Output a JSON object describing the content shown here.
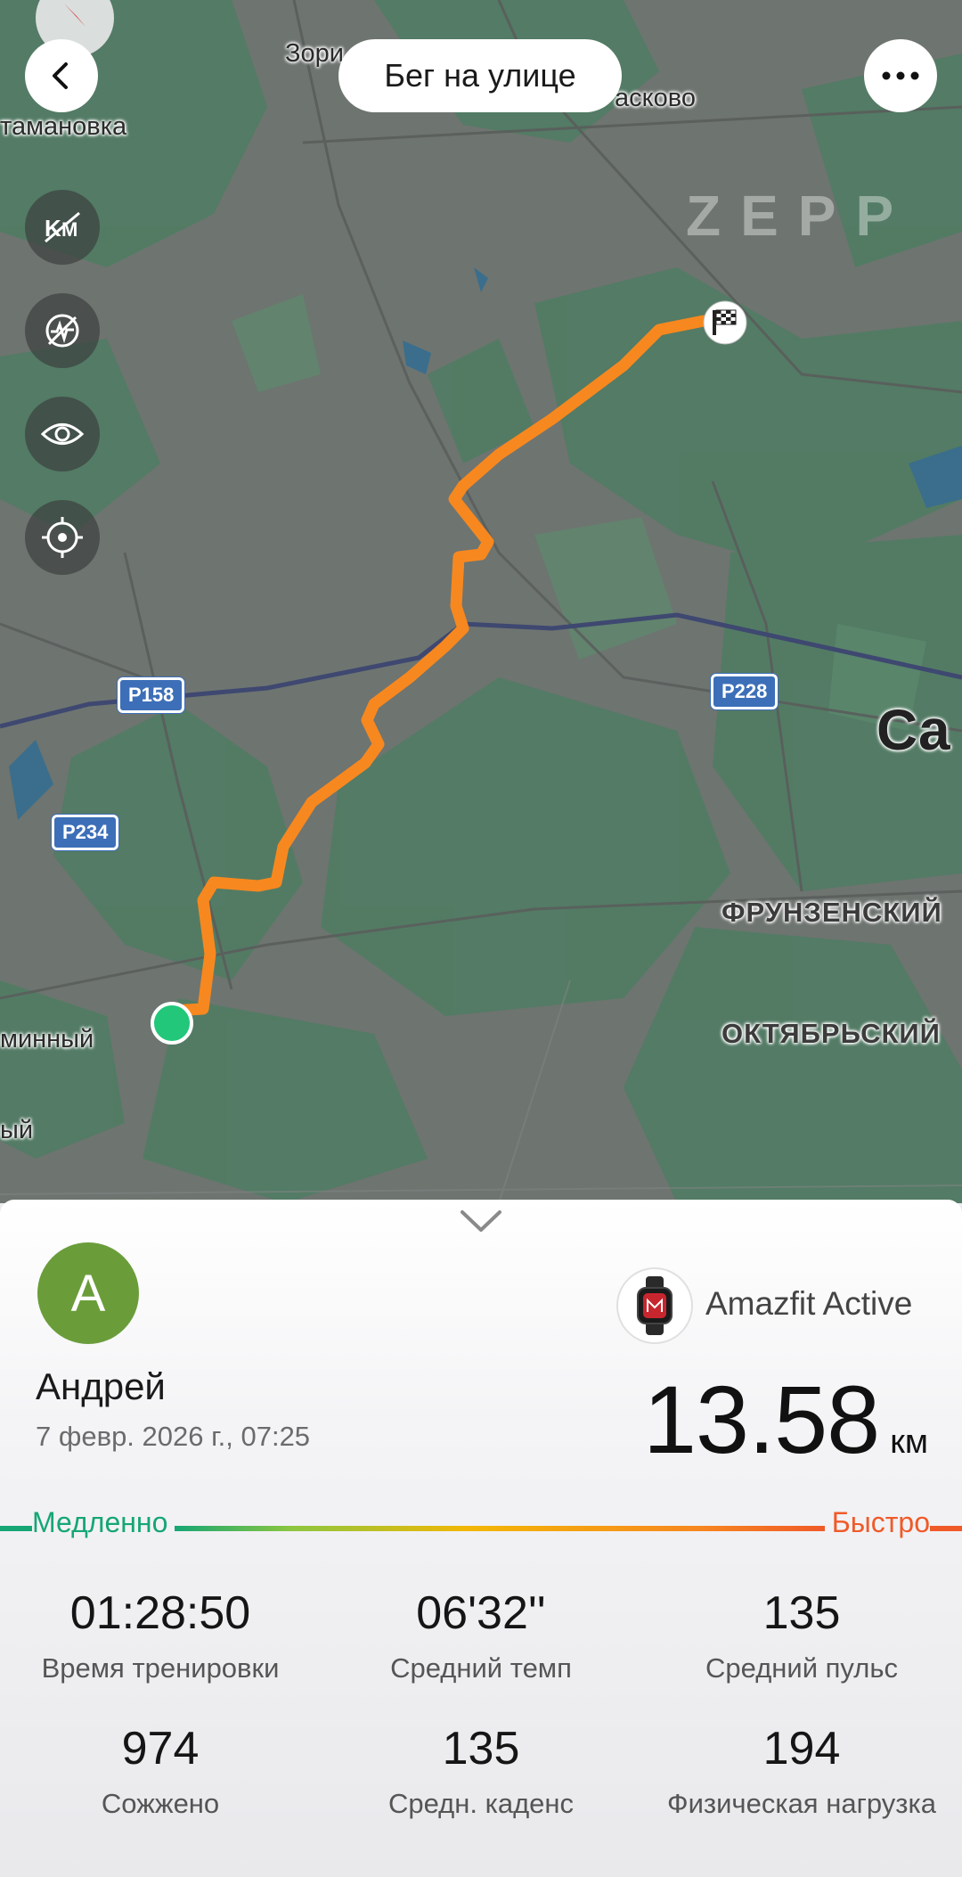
{
  "header": {
    "title": "Бег на улице",
    "brand": "ZEPP"
  },
  "map": {
    "labels": {
      "top_left_village": "Зори",
      "left_village": "тамановка",
      "top_right_village": "асково",
      "city": "Са",
      "district_1": "ФРУНЗЕНСКИЙ",
      "district_2": "ОКТЯБРЬСКИЙ",
      "bottom_left_1": "минный",
      "bottom_left_2": "ый"
    },
    "road_signs": [
      "Р158",
      "Р228",
      "Р234"
    ],
    "route_color": "#f7881f",
    "start_color": "#22c77a"
  },
  "workout": {
    "user_initial": "А",
    "user_name": "Андрей",
    "date": "7 февр. 2026 г., 07:25",
    "device": "Amazfit Active",
    "distance": "13.58",
    "distance_unit": "км",
    "pace_scale": {
      "slow": "Медленно",
      "fast": "Быстро"
    },
    "stats": [
      {
        "value": "01:28:50",
        "label": "Время тренировки"
      },
      {
        "value": "06'32''",
        "label": "Средний темп"
      },
      {
        "value": "135",
        "label": "Средний пульс"
      },
      {
        "value": "974",
        "label": "Сожжено"
      },
      {
        "value": "135",
        "label": "Средн. каденс"
      },
      {
        "value": "194",
        "label": "Физическая нагрузка"
      }
    ]
  }
}
